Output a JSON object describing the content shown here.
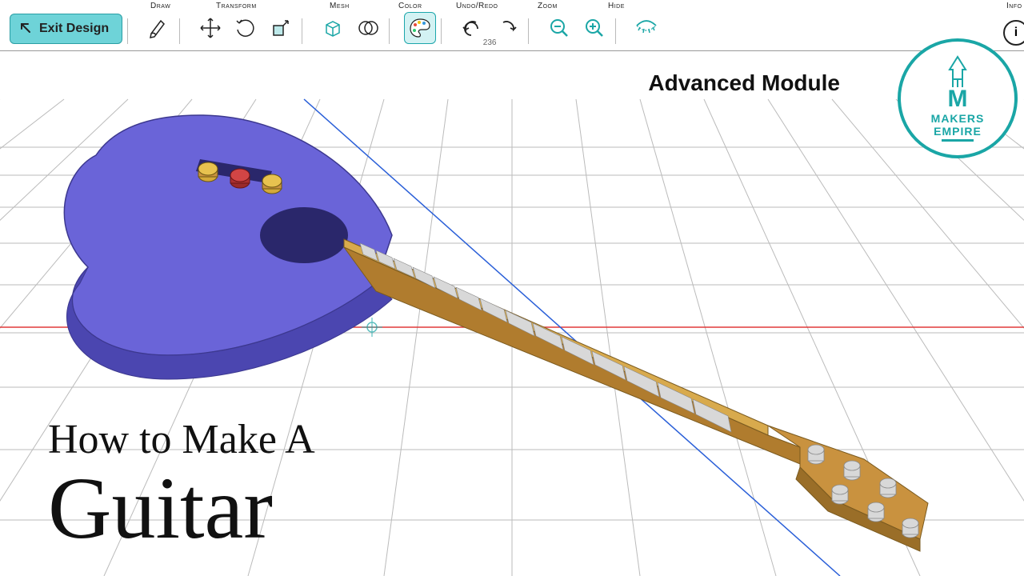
{
  "toolbar": {
    "exit_label": "Exit Design",
    "groups": {
      "draw": "Draw",
      "transform": "Transform",
      "mesh": "Mesh",
      "color": "Color",
      "undoredo": "Undo/Redo",
      "zoom": "Zoom",
      "hide": "Hide",
      "info": "Info"
    },
    "undo_count": "236"
  },
  "overlay": {
    "module_label": "Advanced Module",
    "title_line1": "How to Make A",
    "title_line2": "Guitar"
  },
  "logo": {
    "line1": "MAKERS",
    "line2": "EMPIRE"
  },
  "colors": {
    "accent": "#1aa6a6",
    "guitar_body": "#6a64d8",
    "guitar_neck": "#c9923f",
    "fret": "#cfcfcf",
    "knob_gold": "#d4a93a",
    "knob_red": "#c43a3a"
  }
}
